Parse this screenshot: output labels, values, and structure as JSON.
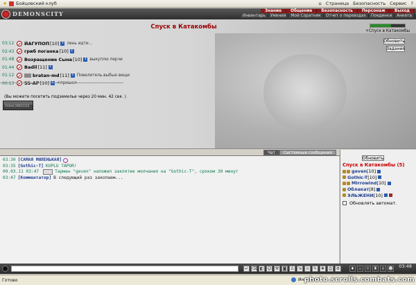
{
  "browser": {
    "tab_title": "Бойцовский клуб",
    "tools": {
      "page": "Страница",
      "security": "Безопасность",
      "service": "Сервис",
      "help": "?"
    }
  },
  "header": {
    "logo_text": "DEMONSCITY",
    "menu_top": [
      "Знание",
      "Общение",
      "Безопасность",
      "Персонаж",
      "Выход"
    ],
    "menu_bottom": [
      "Инвентарь",
      "Умения",
      "Мой Соратник",
      "Отчет о переводах",
      "Поединки",
      "Анкета"
    ]
  },
  "game": {
    "location_title": "Спуск в Катакомбы",
    "hp_fraction": 0.6,
    "side_label": "+Спуск в Катакомбы",
    "refresh_label": "Обновить",
    "tasks_label": "Задания",
    "players": [
      {
        "time": "03:12",
        "name": "ЙАГУПОП",
        "level": "[10]",
        "message": "лень идти..."
      },
      {
        "time": "02:43",
        "name": "гриб поганка",
        "level": "[10]",
        "message": ""
      },
      {
        "time": "01:48",
        "name": "Возращение Сына",
        "level": "[10]",
        "message": "выкуплю перчи"
      },
      {
        "time": "01:44",
        "name": "Badil",
        "level": "[11]",
        "message": ""
      },
      {
        "time": "01:12",
        "name": "bratan-md",
        "level": "[11]",
        "message": "Повелитель.выбью вещи"
      },
      {
        "time": "00:13",
        "name": "SS-AP",
        "level": "[10]",
        "message": "+пришел"
      }
    ],
    "notice": "(Вы можете посетить подземелье через 20 мин. 42 сек. )",
    "counter_text": "Visited 28641324"
  },
  "chat": {
    "tab_chat": "Чат",
    "tab_system": "Системные сообщения",
    "lines": [
      {
        "time": "03:30",
        "nick": "[САМАЯ МИЛЕНЬКАЯ]",
        "text": "",
        "green": ""
      },
      {
        "time": "03:35",
        "nick": "[Gothic-T]",
        "text": "",
        "green": "KUPLU TAPOR!"
      },
      {
        "time": "09.03.11 03:47",
        "nick": "",
        "text": "",
        "green": "Тарман \"geven\" наложил заклятие молчания на \"Gothic-T\", сроком 30 минут"
      },
      {
        "time": "03:47",
        "nick": "[Комментатор]",
        "text": "В следующий раз закопаем...",
        "green": ""
      }
    ]
  },
  "room": {
    "refresh_label": "Обновить",
    "title": "Спуск в Катакомбы (5)",
    "users": [
      {
        "name": "geven",
        "level": "[10]"
      },
      {
        "name": "Gothic-T",
        "level": "[10]"
      },
      {
        "name": "Mirrowind",
        "level": "[10]"
      },
      {
        "name": "Облакат",
        "level": "[8]"
      },
      {
        "name": "ЭЛЬЖЕНИ",
        "level": "[10]"
      }
    ],
    "auto_refresh_label": "Обновлять автомат."
  },
  "bottom_bar": {
    "clock": "03:48"
  },
  "status_bar": {
    "left": "Готово",
    "zone": "Интернет",
    "watermark": "photo.scrolls.combats.com"
  }
}
